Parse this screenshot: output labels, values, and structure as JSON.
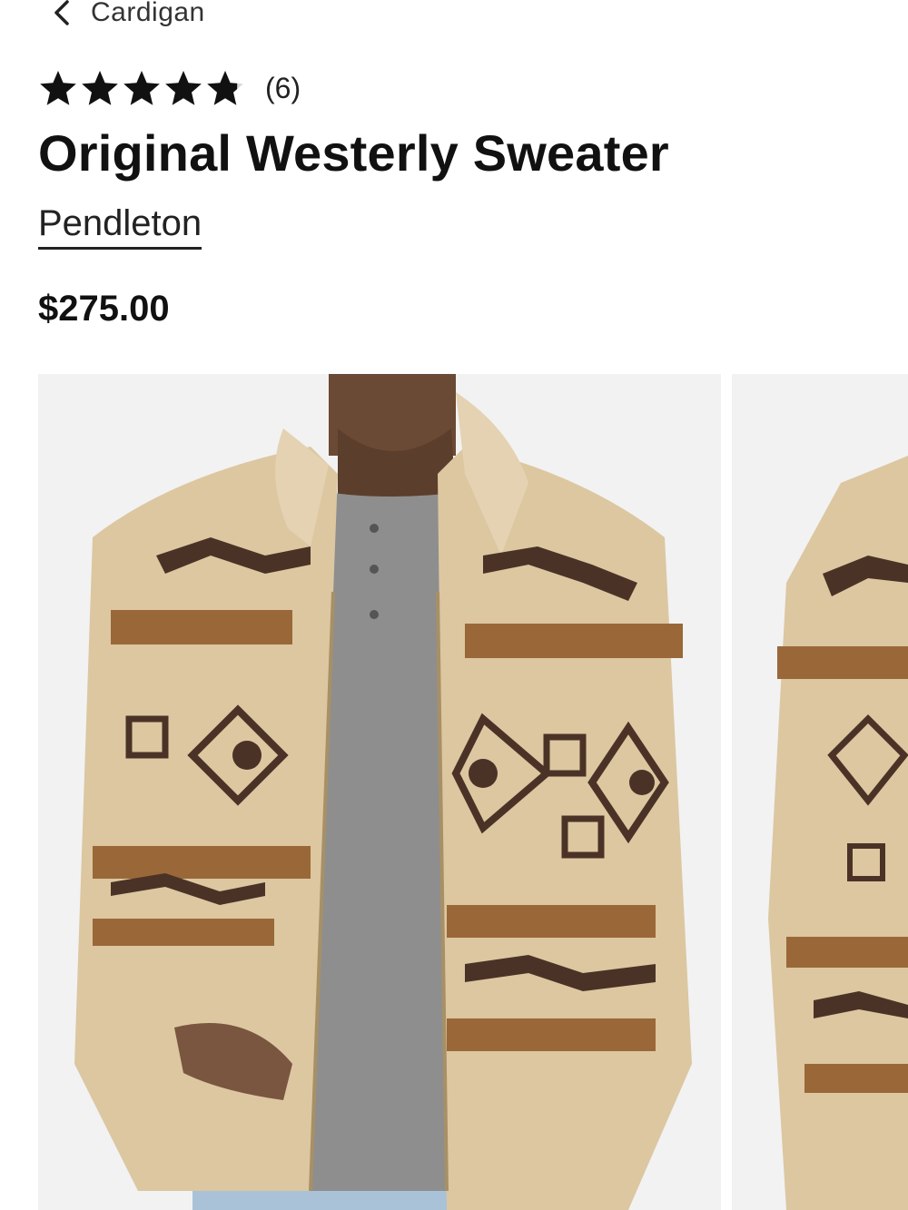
{
  "nav": {
    "back_label": "Cardigan"
  },
  "rating": {
    "value": 4.8,
    "max": 5,
    "count_label": "(6)"
  },
  "product": {
    "title": "Original Westerly Sweater",
    "brand": "Pendleton",
    "price": "$275.00"
  },
  "gallery": {
    "images": [
      {
        "alt": ""
      },
      {
        "alt": ""
      }
    ]
  },
  "colors": {
    "text": "#111111",
    "image_bg": "#f2f2f2",
    "sweater_tan": "#dcc7a1",
    "stripe_brown": "#9a6838",
    "pattern_dark": "#4a3326",
    "henley_gray": "#8e8e8e",
    "denim": "#a9c2d8"
  }
}
